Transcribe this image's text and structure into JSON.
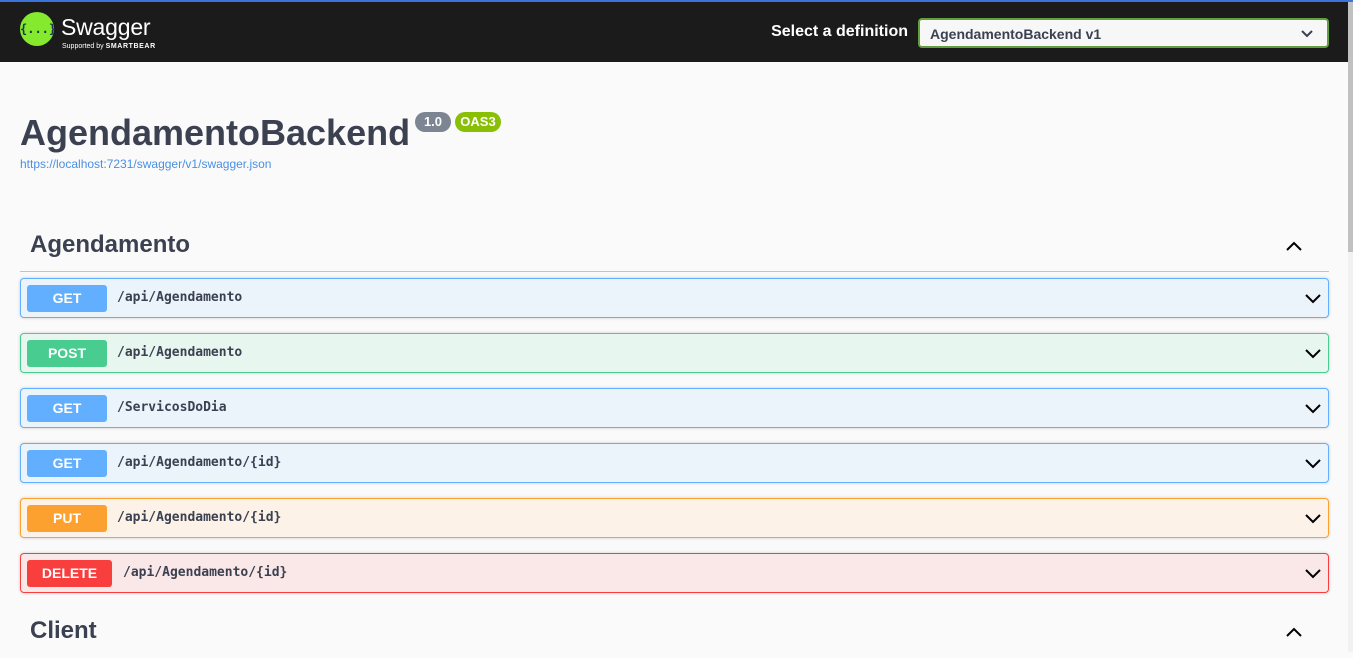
{
  "brand": {
    "logo_glyph": "{...}",
    "name": "Swagger",
    "sub_prefix": "Supported by",
    "sub_brand": "SMARTBEAR",
    "color": "#85ea2d"
  },
  "definition": {
    "label": "Select a definition",
    "selected": "AgendamentoBackend v1"
  },
  "info": {
    "title": "AgendamentoBackend",
    "version": "1.0",
    "oas": "OAS3",
    "spec_url": "https://localhost:7231/swagger/v1/swagger.json"
  },
  "tags": [
    {
      "name": "Agendamento",
      "expanded": true,
      "operations": [
        {
          "method": "GET",
          "path": "/api/Agendamento"
        },
        {
          "method": "POST",
          "path": "/api/Agendamento"
        },
        {
          "method": "GET",
          "path": "/ServicosDoDia"
        },
        {
          "method": "GET",
          "path": "/api/Agendamento/{id}"
        },
        {
          "method": "PUT",
          "path": "/api/Agendamento/{id}"
        },
        {
          "method": "DELETE",
          "path": "/api/Agendamento/{id}"
        }
      ]
    },
    {
      "name": "Client",
      "expanded": true
    }
  ],
  "colors": {
    "get": "#61affe",
    "post": "#49cc90",
    "put": "#fca130",
    "delete": "#f93e3e",
    "title": "#3b4151",
    "link": "#4990e2"
  },
  "icons": {
    "select_chevron": "chevron-down-icon",
    "tag_toggle": "chevron-up-icon",
    "operation_toggle": "chevron-down-icon"
  }
}
